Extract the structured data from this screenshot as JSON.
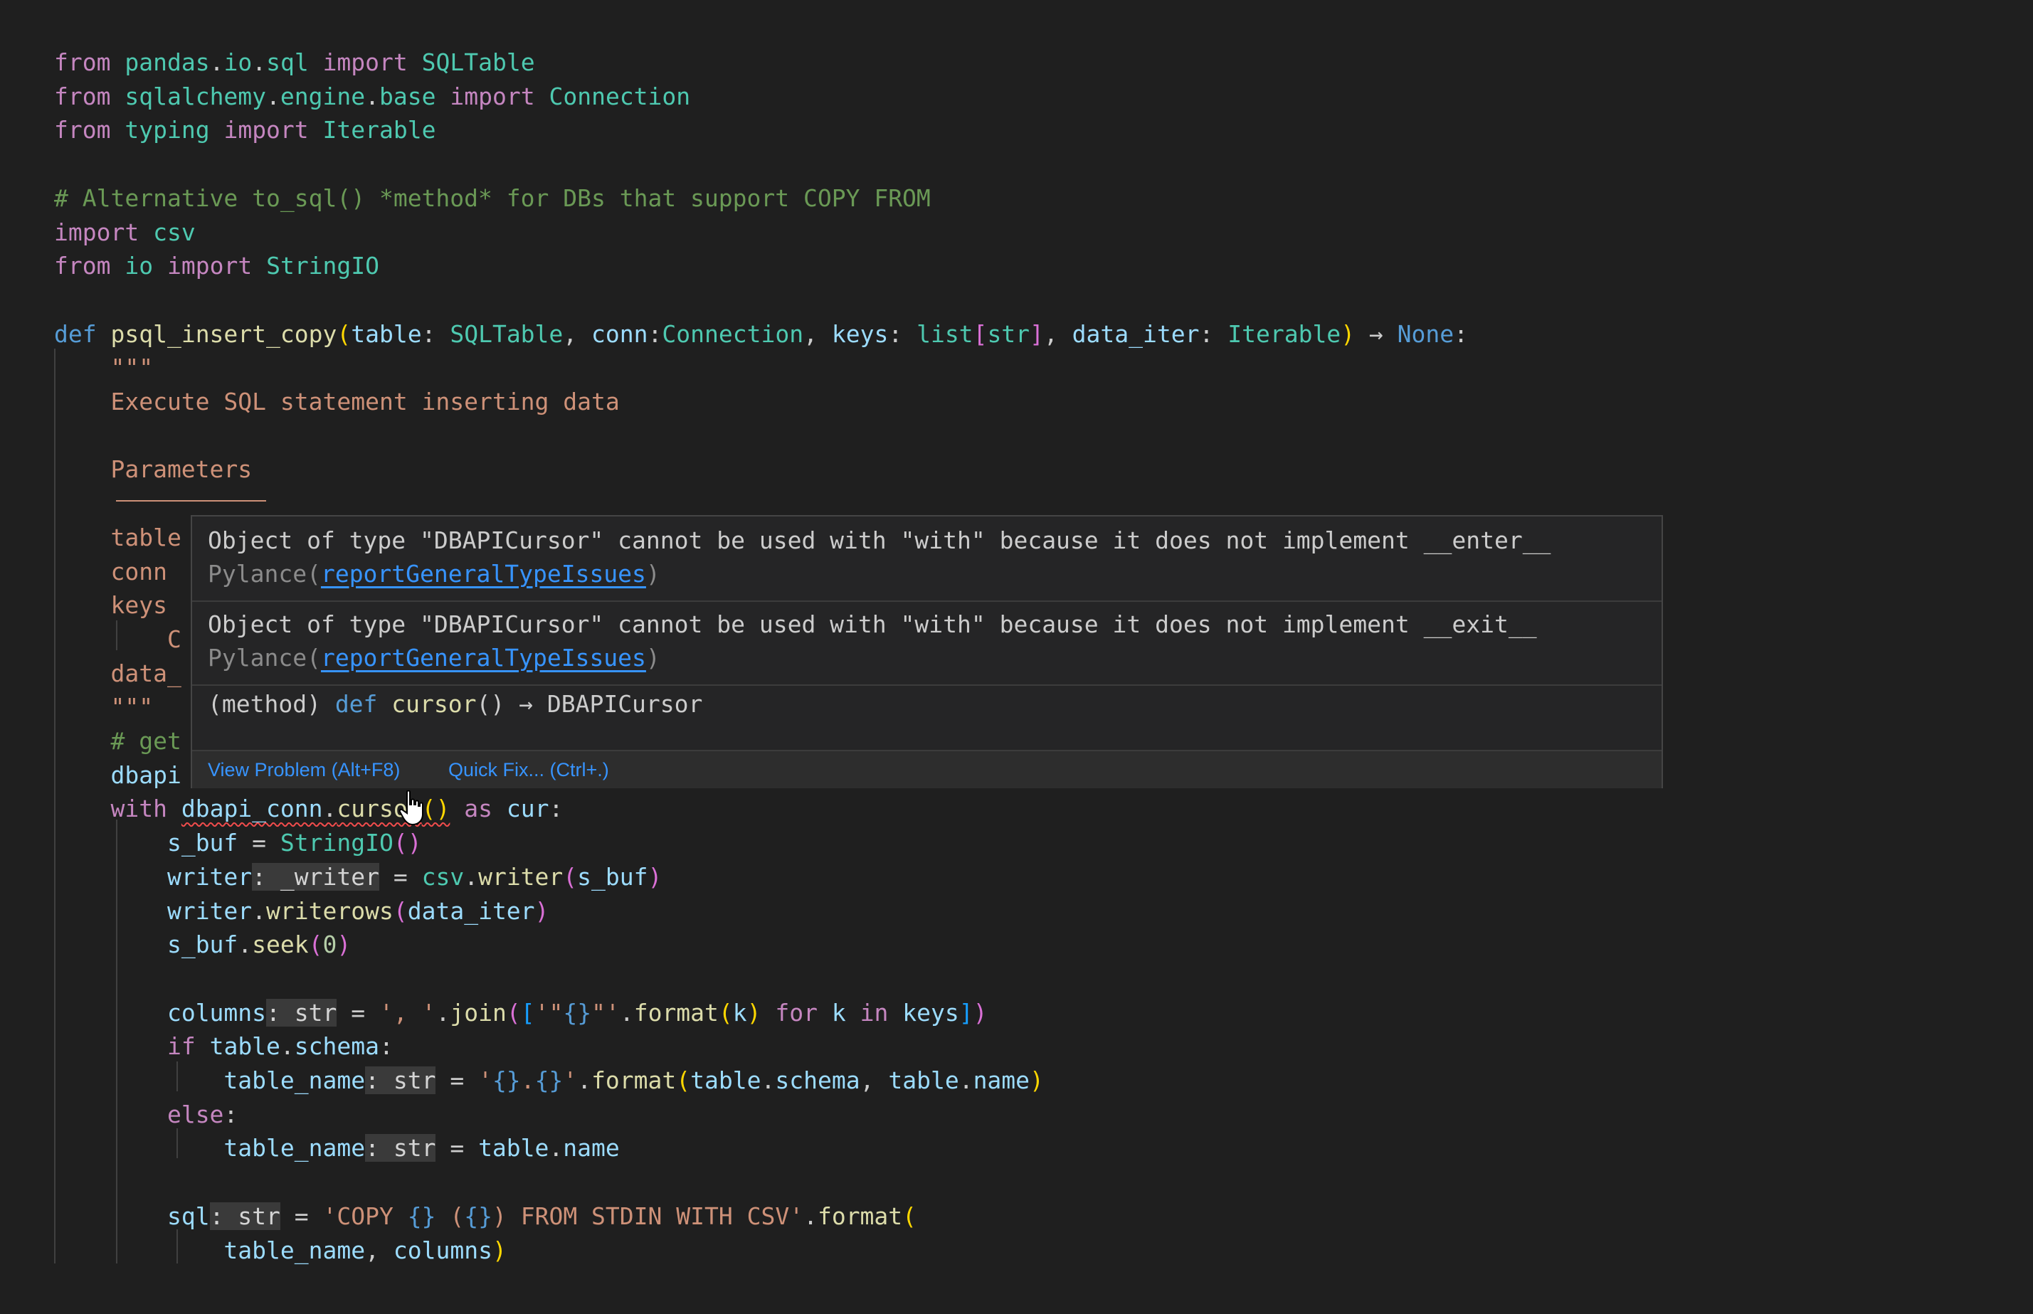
{
  "editor": {
    "lines": [
      {
        "y": 0,
        "tokens": [
          {
            "t": "from",
            "c": "kw"
          },
          {
            "t": " "
          },
          {
            "t": "pandas",
            "c": "cls"
          },
          {
            "t": "."
          },
          {
            "t": "io",
            "c": "cls"
          },
          {
            "t": "."
          },
          {
            "t": "sql",
            "c": "cls"
          },
          {
            "t": " "
          },
          {
            "t": "import",
            "c": "kw"
          },
          {
            "t": " "
          },
          {
            "t": "SQLTable",
            "c": "cls"
          }
        ]
      },
      {
        "y": 1,
        "tokens": [
          {
            "t": "from",
            "c": "kw"
          },
          {
            "t": " "
          },
          {
            "t": "sqlalchemy",
            "c": "cls"
          },
          {
            "t": "."
          },
          {
            "t": "engine",
            "c": "cls"
          },
          {
            "t": "."
          },
          {
            "t": "base",
            "c": "cls"
          },
          {
            "t": " "
          },
          {
            "t": "import",
            "c": "kw"
          },
          {
            "t": " "
          },
          {
            "t": "Connection",
            "c": "cls"
          }
        ]
      },
      {
        "y": 2,
        "tokens": [
          {
            "t": "from",
            "c": "kw"
          },
          {
            "t": " "
          },
          {
            "t": "typing",
            "c": "cls"
          },
          {
            "t": " "
          },
          {
            "t": "import",
            "c": "kw"
          },
          {
            "t": " "
          },
          {
            "t": "Iterable",
            "c": "cls"
          }
        ]
      },
      {
        "y": 4,
        "tokens": [
          {
            "t": "# Alternative to_sql() *method* for DBs that support COPY FROM",
            "c": "cmt"
          }
        ]
      },
      {
        "y": 5,
        "tokens": [
          {
            "t": "import",
            "c": "kw"
          },
          {
            "t": " "
          },
          {
            "t": "csv",
            "c": "cls"
          }
        ]
      },
      {
        "y": 6,
        "tokens": [
          {
            "t": "from",
            "c": "kw"
          },
          {
            "t": " "
          },
          {
            "t": "io",
            "c": "cls"
          },
          {
            "t": " "
          },
          {
            "t": "import",
            "c": "kw"
          },
          {
            "t": " "
          },
          {
            "t": "StringIO",
            "c": "cls"
          }
        ]
      },
      {
        "y": 8,
        "tokens": [
          {
            "t": "def",
            "c": "kwb"
          },
          {
            "t": " "
          },
          {
            "t": "psql_insert_copy",
            "c": "fn"
          },
          {
            "t": "(",
            "c": "ob"
          },
          {
            "t": "table",
            "c": "var"
          },
          {
            "t": ": "
          },
          {
            "t": "SQLTable",
            "c": "cls"
          },
          {
            "t": ", "
          },
          {
            "t": "conn",
            "c": "var"
          },
          {
            "t": ":"
          },
          {
            "t": "Connection",
            "c": "cls"
          },
          {
            "t": ", "
          },
          {
            "t": "keys",
            "c": "var"
          },
          {
            "t": ": "
          },
          {
            "t": "list",
            "c": "cls"
          },
          {
            "t": "[",
            "c": "pb"
          },
          {
            "t": "str",
            "c": "cls"
          },
          {
            "t": "]",
            "c": "pb"
          },
          {
            "t": ", "
          },
          {
            "t": "data_iter",
            "c": "var"
          },
          {
            "t": ": "
          },
          {
            "t": "Iterable",
            "c": "cls"
          },
          {
            "t": ")",
            "c": "ob"
          },
          {
            "t": " → "
          },
          {
            "t": "None",
            "c": "kwb"
          },
          {
            "t": ":"
          }
        ]
      },
      {
        "y": 9,
        "tokens": [
          {
            "t": "    \"\"\"",
            "c": "str"
          }
        ]
      },
      {
        "y": 10,
        "tokens": [
          {
            "t": "    Execute SQL statement inserting data",
            "c": "str"
          }
        ]
      },
      {
        "y": 12,
        "tokens": [
          {
            "t": "    Parameters",
            "c": "str"
          }
        ]
      },
      {
        "y": 14,
        "tokens": [
          {
            "t": "    table",
            "c": "str"
          }
        ]
      },
      {
        "y": 15,
        "tokens": [
          {
            "t": "    conn",
            "c": "str"
          }
        ]
      },
      {
        "y": 16,
        "tokens": [
          {
            "t": "    keys",
            "c": "str"
          }
        ]
      },
      {
        "y": 17,
        "tokens": [
          {
            "t": "        C",
            "c": "str"
          }
        ]
      },
      {
        "y": 18,
        "tokens": [
          {
            "t": "    data_",
            "c": "str"
          }
        ]
      },
      {
        "y": 19,
        "tokens": [
          {
            "t": "    \"\"\"",
            "c": "str"
          }
        ]
      },
      {
        "y": 20,
        "tokens": [
          {
            "t": "    # get",
            "c": "cmt"
          }
        ]
      },
      {
        "y": 21,
        "tokens": [
          {
            "t": "    "
          },
          {
            "t": "dbapi",
            "c": "var"
          }
        ]
      },
      {
        "y": 22,
        "tokens": [
          {
            "t": "    "
          },
          {
            "t": "with",
            "c": "kw"
          },
          {
            "t": " "
          },
          {
            "t": "dbapi_conn",
            "c": "var",
            "s": 1
          },
          {
            "t": ".",
            "s": 1
          },
          {
            "t": "cursor",
            "c": "fn",
            "s": 1
          },
          {
            "t": "()",
            "c": "ob",
            "s": 1
          },
          {
            "t": " "
          },
          {
            "t": "as",
            "c": "kw"
          },
          {
            "t": " "
          },
          {
            "t": "cur",
            "c": "var"
          },
          {
            "t": ":"
          }
        ]
      },
      {
        "y": 23,
        "tokens": [
          {
            "t": "        "
          },
          {
            "t": "s_buf",
            "c": "var"
          },
          {
            "t": " = "
          },
          {
            "t": "StringIO",
            "c": "cls"
          },
          {
            "t": "()",
            "c": "pb"
          }
        ]
      },
      {
        "y": 24,
        "tokens": [
          {
            "t": "        "
          },
          {
            "t": "writer",
            "c": "var"
          },
          {
            "t": ": _writer",
            "c": "hint"
          },
          {
            "t": " = "
          },
          {
            "t": "csv",
            "c": "cls"
          },
          {
            "t": "."
          },
          {
            "t": "writer",
            "c": "fn"
          },
          {
            "t": "(",
            "c": "pb"
          },
          {
            "t": "s_buf",
            "c": "var"
          },
          {
            "t": ")",
            "c": "pb"
          }
        ]
      },
      {
        "y": 25,
        "tokens": [
          {
            "t": "        "
          },
          {
            "t": "writer",
            "c": "var"
          },
          {
            "t": "."
          },
          {
            "t": "writerows",
            "c": "fn"
          },
          {
            "t": "(",
            "c": "pb"
          },
          {
            "t": "data_iter",
            "c": "var"
          },
          {
            "t": ")",
            "c": "pb"
          }
        ]
      },
      {
        "y": 26,
        "tokens": [
          {
            "t": "        "
          },
          {
            "t": "s_buf",
            "c": "var"
          },
          {
            "t": "."
          },
          {
            "t": "seek",
            "c": "fn"
          },
          {
            "t": "(",
            "c": "pb"
          },
          {
            "t": "0",
            "c": "num"
          },
          {
            "t": ")",
            "c": "pb"
          }
        ]
      },
      {
        "y": 28,
        "tokens": [
          {
            "t": "        "
          },
          {
            "t": "columns",
            "c": "var"
          },
          {
            "t": ": str",
            "c": "hint"
          },
          {
            "t": " = "
          },
          {
            "t": "', '",
            "c": "str"
          },
          {
            "t": "."
          },
          {
            "t": "join",
            "c": "fn"
          },
          {
            "t": "(",
            "c": "pb"
          },
          {
            "t": "[",
            "c": "bb"
          },
          {
            "t": "'\"",
            "c": "str"
          },
          {
            "t": "{}",
            "c": "esc"
          },
          {
            "t": "\"'",
            "c": "str"
          },
          {
            "t": "."
          },
          {
            "t": "format",
            "c": "fn"
          },
          {
            "t": "(",
            "c": "ob"
          },
          {
            "t": "k",
            "c": "var"
          },
          {
            "t": ")",
            "c": "ob"
          },
          {
            "t": " "
          },
          {
            "t": "for",
            "c": "kw"
          },
          {
            "t": " "
          },
          {
            "t": "k",
            "c": "var"
          },
          {
            "t": " "
          },
          {
            "t": "in",
            "c": "kw"
          },
          {
            "t": " "
          },
          {
            "t": "keys",
            "c": "var"
          },
          {
            "t": "]",
            "c": "bb"
          },
          {
            "t": ")",
            "c": "pb"
          }
        ]
      },
      {
        "y": 29,
        "tokens": [
          {
            "t": "        "
          },
          {
            "t": "if",
            "c": "kw"
          },
          {
            "t": " "
          },
          {
            "t": "table",
            "c": "var"
          },
          {
            "t": "."
          },
          {
            "t": "schema",
            "c": "var"
          },
          {
            "t": ":"
          }
        ]
      },
      {
        "y": 30,
        "tokens": [
          {
            "t": "            "
          },
          {
            "t": "table_name",
            "c": "var"
          },
          {
            "t": ": str",
            "c": "hint"
          },
          {
            "t": " = "
          },
          {
            "t": "'",
            "c": "str"
          },
          {
            "t": "{}",
            "c": "esc"
          },
          {
            "t": ".",
            "c": "str"
          },
          {
            "t": "{}",
            "c": "esc"
          },
          {
            "t": "'",
            "c": "str"
          },
          {
            "t": "."
          },
          {
            "t": "format",
            "c": "fn"
          },
          {
            "t": "(",
            "c": "ob"
          },
          {
            "t": "table",
            "c": "var"
          },
          {
            "t": "."
          },
          {
            "t": "schema",
            "c": "var"
          },
          {
            "t": ", "
          },
          {
            "t": "table",
            "c": "var"
          },
          {
            "t": "."
          },
          {
            "t": "name",
            "c": "var"
          },
          {
            "t": ")",
            "c": "ob"
          }
        ]
      },
      {
        "y": 31,
        "tokens": [
          {
            "t": "        "
          },
          {
            "t": "else",
            "c": "kw"
          },
          {
            "t": ":"
          }
        ]
      },
      {
        "y": 32,
        "tokens": [
          {
            "t": "            "
          },
          {
            "t": "table_name",
            "c": "var"
          },
          {
            "t": ": str",
            "c": "hint"
          },
          {
            "t": " = "
          },
          {
            "t": "table",
            "c": "var"
          },
          {
            "t": "."
          },
          {
            "t": "name",
            "c": "var"
          }
        ]
      },
      {
        "y": 34,
        "tokens": [
          {
            "t": "        "
          },
          {
            "t": "sql",
            "c": "var"
          },
          {
            "t": ": str",
            "c": "hint"
          },
          {
            "t": " = "
          },
          {
            "t": "'COPY ",
            "c": "str"
          },
          {
            "t": "{}",
            "c": "esc"
          },
          {
            "t": " (",
            "c": "str"
          },
          {
            "t": "{}",
            "c": "esc"
          },
          {
            "t": ") FROM STDIN WITH CSV'",
            "c": "str"
          },
          {
            "t": "."
          },
          {
            "t": "format",
            "c": "fn"
          },
          {
            "t": "(",
            "c": "ob"
          }
        ]
      },
      {
        "y": 35,
        "tokens": [
          {
            "t": "            "
          },
          {
            "t": "table_name",
            "c": "var"
          },
          {
            "t": ", "
          },
          {
            "t": "columns",
            "c": "var"
          },
          {
            "t": ")",
            "c": "ob"
          }
        ]
      }
    ]
  },
  "hover": {
    "problem1": {
      "message": "Object of type \"DBAPICursor\" cannot be used with \"with\" because it does not implement __enter__",
      "source": "Pylance(",
      "code": "reportGeneralTypeIssues",
      "close": ")"
    },
    "problem2": {
      "message": "Object of type \"DBAPICursor\" cannot be used with \"with\" because it does not implement __exit__",
      "source": "Pylance(",
      "code": "reportGeneralTypeIssues",
      "close": ")"
    },
    "signature": {
      "prefix": "(method) ",
      "kw": "def",
      "name": "cursor",
      "rest": "() → DBAPICursor"
    },
    "view_problem": "View Problem (Alt+F8)",
    "quick_fix": "Quick Fix... (Ctrl+.)"
  },
  "colors": {
    "background": "#1f1f1f",
    "hover_bg": "#252526",
    "link": "#3794ff",
    "error": "#f14c4c"
  },
  "icons": {
    "cursor": "hand-pointer-icon"
  }
}
